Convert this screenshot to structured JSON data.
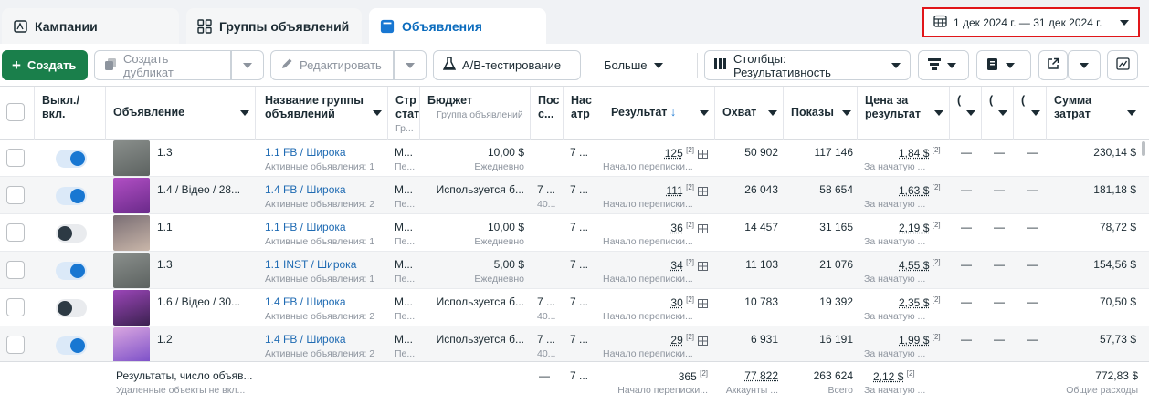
{
  "tabs": [
    {
      "label": "Кампании",
      "icon": "campaign-icon"
    },
    {
      "label": "Группы объявлений",
      "icon": "adsets-icon"
    },
    {
      "label": "Объявления",
      "icon": "ads-icon"
    }
  ],
  "date_range": "1 дек 2024 г. — 31 дек 2024 г.",
  "toolbar": {
    "create": "Создать",
    "duplicate": "Создать дубликат",
    "edit": "Редактировать",
    "ab_test": "A/B-тестирование",
    "more": "Больше",
    "columns": "Столбцы: Результативность"
  },
  "columns": {
    "toggle": "Выкл./ вкл.",
    "ad": "Объявление",
    "adset": "Название группы объявлений",
    "strategy": "Стр стат",
    "strategy_sub": "Гр...",
    "budget": "Бюджет",
    "budget_sub": "Группа объявлений",
    "last": "Пос с...",
    "settings": "Нас атр",
    "result": "Результат",
    "reach": "Охват",
    "impressions": "Показы",
    "cpr": "Цена за результат",
    "c1": "(",
    "c2": "(",
    "c3": "(",
    "spend": "Сумма затрат"
  },
  "rows": [
    {
      "ad": "1.3",
      "on": true,
      "adset": "1.1 FB / Широка",
      "adset_sub": "Активные объявления: 1",
      "strat": "M...",
      "strat_sub": "Пе...",
      "budget": "10,00 $",
      "budget_sub": "Ежедневно",
      "last": "",
      "last_sub": "",
      "attr": "7 ...",
      "result": "125",
      "result_sub": "Начало переписки...",
      "reach": "50 902",
      "impr": "117 146",
      "cpr": "1,84 $",
      "cpr_sub": "За начатую ...",
      "d1": "—",
      "d2": "—",
      "d3": "—",
      "spend": "230,14 $",
      "thumb": [
        "#8a8f8c",
        "#5c6260"
      ]
    },
    {
      "ad": "1.4 / Відео / 28...",
      "on": true,
      "adset": "1.4 FB / Широка",
      "adset_sub": "Активные объявления: 2",
      "strat": "M...",
      "strat_sub": "Пе...",
      "budget": "Используется б...",
      "budget_sub": "",
      "last": "7 ...",
      "last_sub": "40...",
      "attr": "7 ...",
      "result": "111",
      "result_sub": "Начало переписки...",
      "reach": "26 043",
      "impr": "58 654",
      "cpr": "1,63 $",
      "cpr_sub": "За начатую ...",
      "d1": "—",
      "d2": "—",
      "d3": "—",
      "spend": "181,18 $",
      "thumb": [
        "#b14fc4",
        "#6a2a8a"
      ]
    },
    {
      "ad": "1.1",
      "on": false,
      "adset": "1.1 FB / Широка",
      "adset_sub": "Активные объявления: 1",
      "strat": "M...",
      "strat_sub": "Пе...",
      "budget": "10,00 $",
      "budget_sub": "Ежедневно",
      "last": "",
      "last_sub": "",
      "attr": "7 ...",
      "result": "36",
      "result_sub": "Начало переписки...",
      "reach": "14 457",
      "impr": "31 165",
      "cpr": "2,19 $",
      "cpr_sub": "За начатую ...",
      "d1": "—",
      "d2": "—",
      "d3": "—",
      "spend": "78,72 $",
      "thumb": [
        "#7a6e74",
        "#c9b6a9"
      ]
    },
    {
      "ad": "1.3",
      "on": true,
      "adset": "1.1 INST / Широка",
      "adset_sub": "Активные объявления: 1",
      "strat": "M...",
      "strat_sub": "Пе...",
      "budget": "5,00 $",
      "budget_sub": "Ежедневно",
      "last": "",
      "last_sub": "",
      "attr": "7 ...",
      "result": "34",
      "result_sub": "Начало переписки...",
      "reach": "11 103",
      "impr": "21 076",
      "cpr": "4,55 $",
      "cpr_sub": "За начатую ...",
      "d1": "—",
      "d2": "—",
      "d3": "—",
      "spend": "154,56 $",
      "thumb": [
        "#8a8f8c",
        "#5c6260"
      ]
    },
    {
      "ad": "1.6 / Відео / 30...",
      "on": false,
      "adset": "1.4 FB / Широка",
      "adset_sub": "Активные объявления: 2",
      "strat": "M...",
      "strat_sub": "Пе...",
      "budget": "Используется б...",
      "budget_sub": "",
      "last": "7 ...",
      "last_sub": "40...",
      "attr": "7 ...",
      "result": "30",
      "result_sub": "Начало переписки...",
      "reach": "10 783",
      "impr": "19 392",
      "cpr": "2,35 $",
      "cpr_sub": "За начатую ...",
      "d1": "—",
      "d2": "—",
      "d3": "—",
      "spend": "70,50 $",
      "thumb": [
        "#9b46b8",
        "#3b2150"
      ]
    },
    {
      "ad": "1.2",
      "on": true,
      "adset": "1.4 FB / Широка",
      "adset_sub": "Активные объявления: 2",
      "strat": "M...",
      "strat_sub": "Пе...",
      "budget": "Используется б...",
      "budget_sub": "",
      "last": "7 ...",
      "last_sub": "40...",
      "attr": "7 ...",
      "result": "29",
      "result_sub": "Начало переписки...",
      "reach": "6 931",
      "impr": "16 191",
      "cpr": "1,99 $",
      "cpr_sub": "За начатую ...",
      "d1": "—",
      "d2": "—",
      "d3": "—",
      "spend": "57,73 $",
      "thumb": [
        "#d9a6e0",
        "#7b4fc8"
      ]
    }
  ],
  "totals": {
    "label": "Результаты, число объяв...",
    "label_sub": "Удаленные объекты не вкл...",
    "last": "—",
    "attr": "7 ...",
    "result": "365",
    "result_sub": "Начало переписки...",
    "reach": "77 822",
    "reach_sub": "Аккаунты ...",
    "impr": "263 624",
    "impr_sub": "Всего",
    "cpr": "2,12 $",
    "cpr_sub": "За начатую ...",
    "spend": "772,83 $",
    "spend_sub": "Общие расходы"
  },
  "footnote_mark": "[2]",
  "colors": {
    "accent": "#1877d2",
    "create_button": "#1a7f4b",
    "date_highlight": "#e1161a",
    "link": "#1f6bb3"
  }
}
